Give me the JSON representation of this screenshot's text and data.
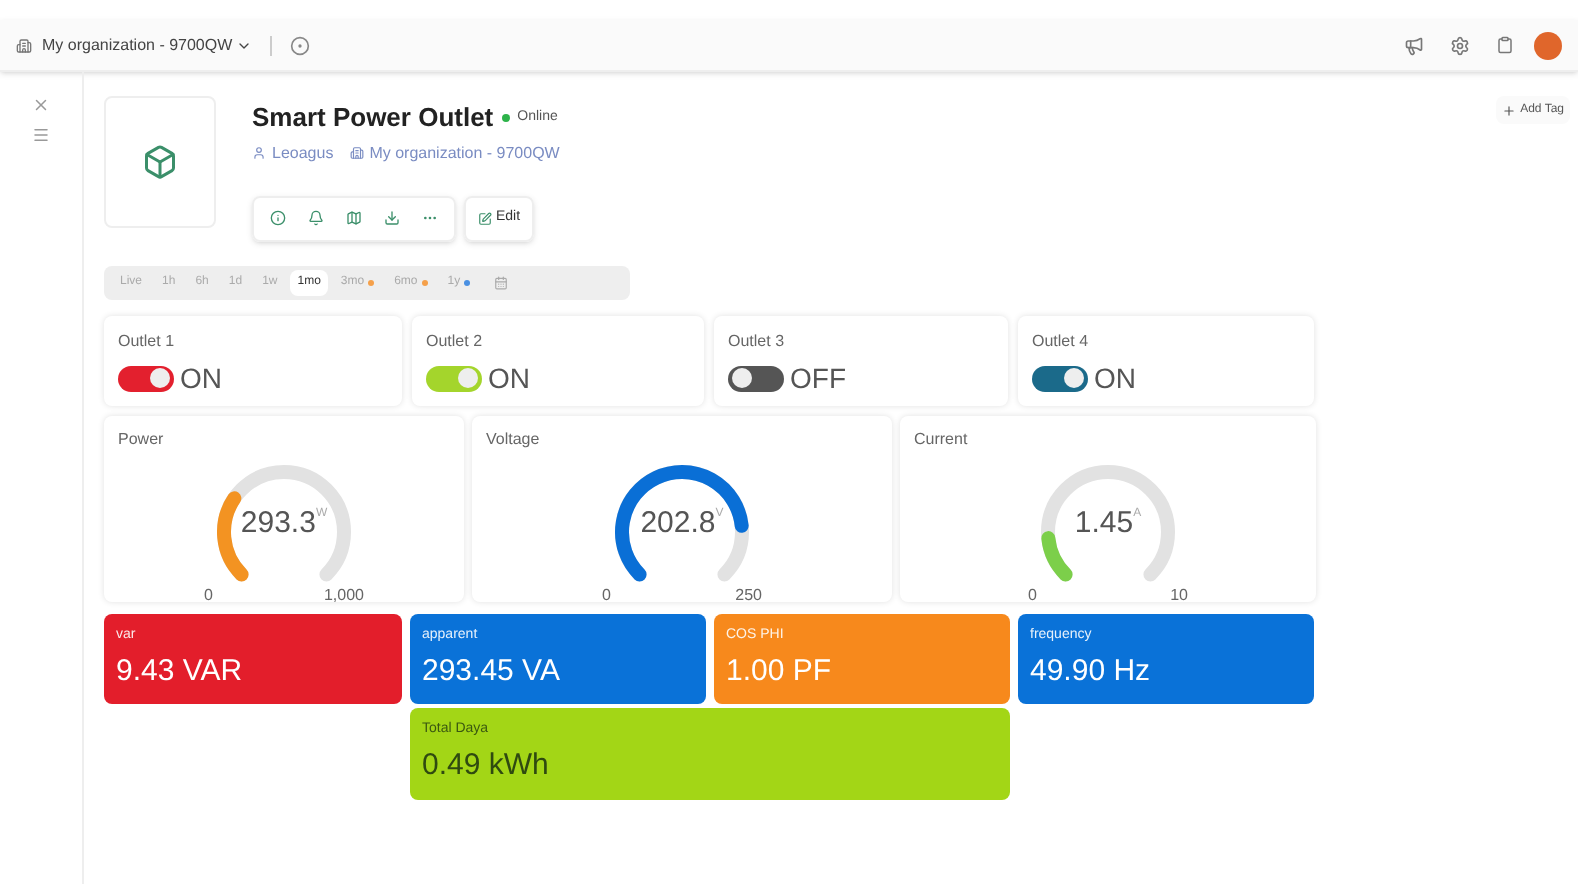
{
  "top_bar": {
    "organization": "My organization - 9700QW"
  },
  "device": {
    "title": "Smart Power Outlet",
    "status": "Online",
    "online": true,
    "owner": "Leoagus",
    "organization": "My organization - 9700QW",
    "edit_label": "Edit",
    "add_tag": "Add Tag"
  },
  "time_ranges": [
    {
      "label": "Live",
      "selected": false
    },
    {
      "label": "1h",
      "selected": false
    },
    {
      "label": "6h",
      "selected": false
    },
    {
      "label": "1d",
      "selected": false
    },
    {
      "label": "1w",
      "selected": false
    },
    {
      "label": "1mo",
      "selected": true
    },
    {
      "label": "3mo",
      "selected": false,
      "color": "#f5a04a"
    },
    {
      "label": "6mo",
      "selected": false,
      "color": "#f5a04a"
    },
    {
      "label": "1y",
      "selected": false,
      "color": "#4a90e2"
    }
  ],
  "outlets": [
    {
      "label": "Outlet 1",
      "on": true,
      "state": "ON",
      "color": "#e3202e"
    },
    {
      "label": "Outlet 2",
      "on": true,
      "state": "ON",
      "color": "#a4d52c"
    },
    {
      "label": "Outlet 3",
      "on": false,
      "state": "OFF",
      "color": "#555555"
    },
    {
      "label": "Outlet 4",
      "on": true,
      "state": "ON",
      "color": "#1b6a8a"
    }
  ],
  "gauges": [
    {
      "label": "Power",
      "value": "293.3",
      "unit": "W",
      "min": "0",
      "max": "1,000",
      "color": "#f39322"
    },
    {
      "label": "Voltage",
      "value": "202.8",
      "unit": "V",
      "min": "0",
      "max": "250",
      "color": "#0a6fd6"
    },
    {
      "label": "Current",
      "value": "1.45",
      "unit": "A",
      "min": "0",
      "max": "10",
      "color": "#7ccf4a"
    }
  ],
  "tiles": [
    {
      "label": "var",
      "value": "9.43 VAR",
      "color": "#e31e2b"
    },
    {
      "label": "apparent",
      "value": "293.45 VA",
      "color": "#0a72d8"
    },
    {
      "label": "COS PHI",
      "value": "1.00 PF",
      "color": "#f7891c"
    },
    {
      "label": "frequency",
      "value": "49.90 Hz",
      "color": "#0a72d8"
    },
    {
      "label": "Total Daya",
      "value": "0.49 kWh",
      "color": "#a3d616"
    }
  ]
}
